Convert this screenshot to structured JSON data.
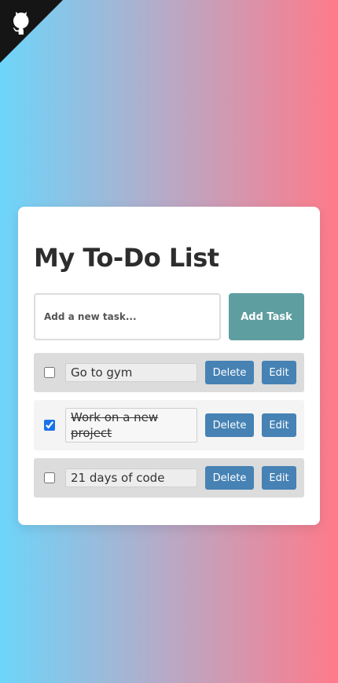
{
  "corner": {
    "icon": "github-octocat-icon"
  },
  "app": {
    "title": "My To-Do List",
    "input_placeholder": "Add a new task...",
    "input_value": "",
    "add_button": "Add Task"
  },
  "tasks": [
    {
      "text": "Go to gym",
      "completed": false,
      "delete_label": "Delete",
      "edit_label": "Edit"
    },
    {
      "text": "Work on a new project",
      "completed": true,
      "delete_label": "Delete",
      "edit_label": "Edit"
    },
    {
      "text": "21 days of code",
      "completed": false,
      "delete_label": "Delete",
      "edit_label": "Edit"
    }
  ],
  "colors": {
    "gradient_start": "#6dd5fa",
    "gradient_end": "#ff7a8a",
    "add_button": "#5f9ea0",
    "action_button": "#4682b4",
    "checkbox": "#1a73e8"
  }
}
